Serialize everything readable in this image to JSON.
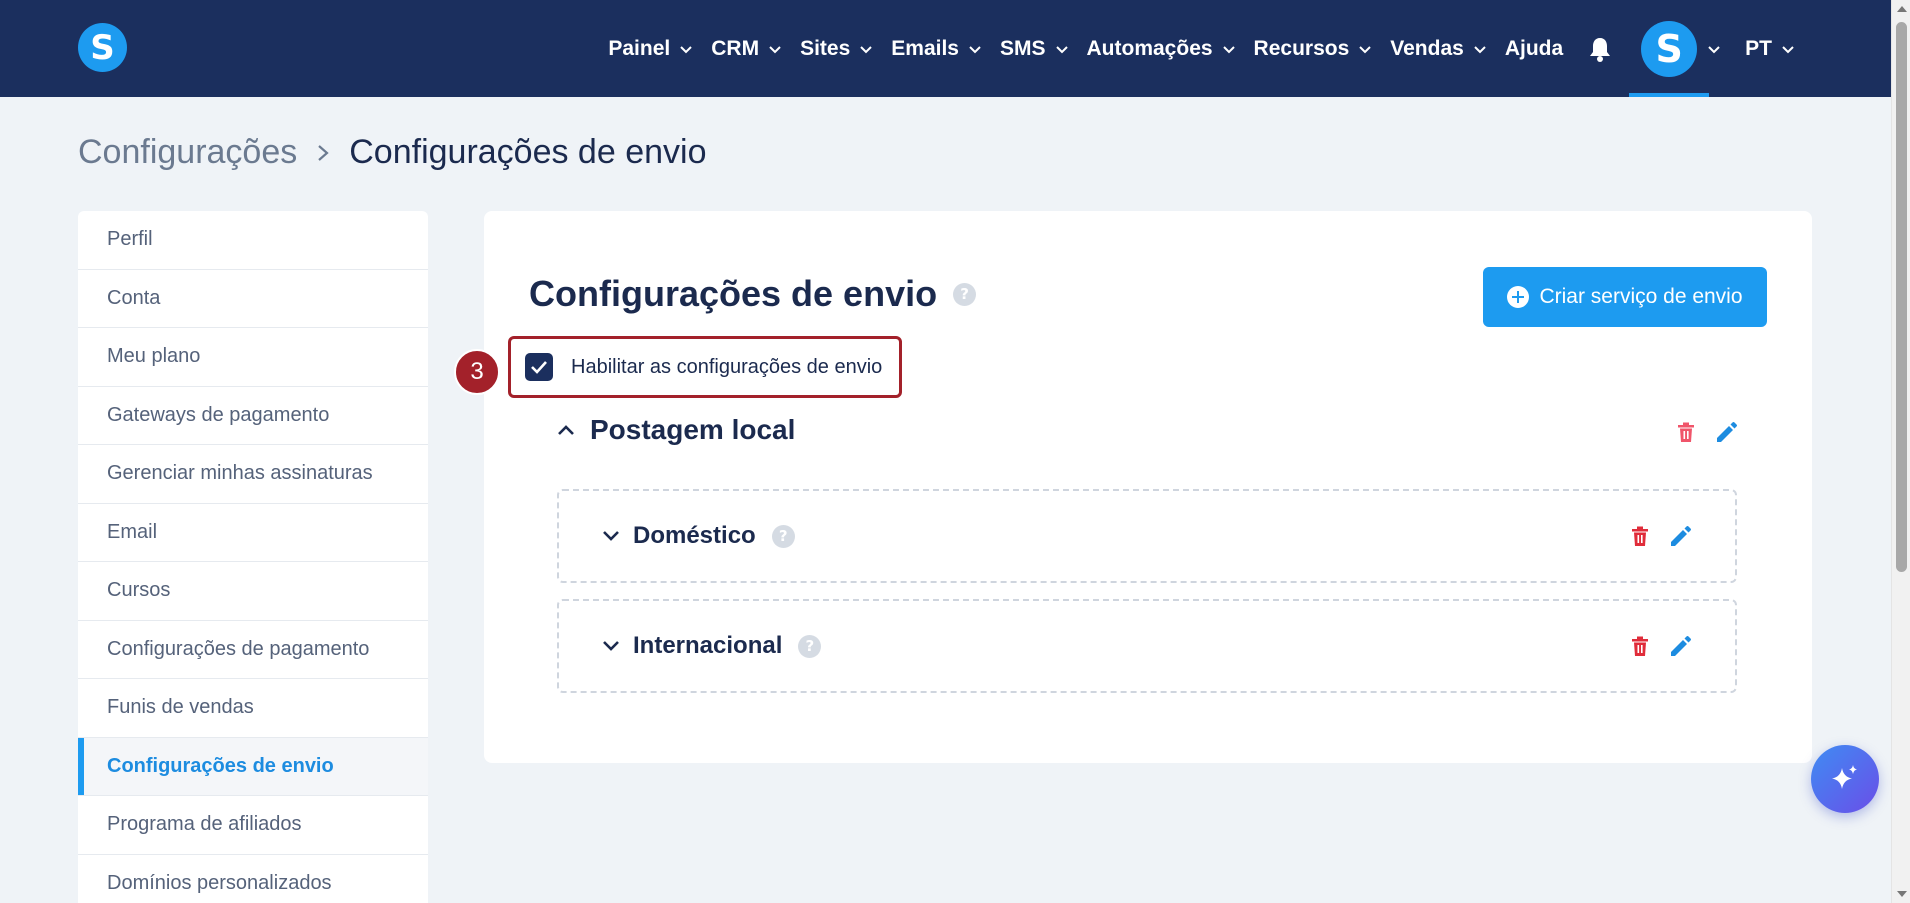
{
  "header": {
    "logo_letter": "S",
    "nav": [
      {
        "label": "Painel",
        "has_dropdown": true
      },
      {
        "label": "CRM",
        "has_dropdown": true
      },
      {
        "label": "Sites",
        "has_dropdown": true
      },
      {
        "label": "Emails",
        "has_dropdown": true
      },
      {
        "label": "SMS",
        "has_dropdown": true
      },
      {
        "label": "Automações",
        "has_dropdown": true
      },
      {
        "label": "Recursos",
        "has_dropdown": true
      },
      {
        "label": "Vendas",
        "has_dropdown": true
      },
      {
        "label": "Ajuda",
        "has_dropdown": false
      }
    ],
    "avatar_letter": "S",
    "language": "PT"
  },
  "breadcrumb": {
    "parent": "Configurações",
    "current": "Configurações de envio"
  },
  "sidebar": {
    "items": [
      {
        "label": "Perfil",
        "active": false
      },
      {
        "label": "Conta",
        "active": false
      },
      {
        "label": "Meu plano",
        "active": false
      },
      {
        "label": "Gateways de pagamento",
        "active": false
      },
      {
        "label": "Gerenciar minhas assinaturas",
        "active": false
      },
      {
        "label": "Email",
        "active": false
      },
      {
        "label": "Cursos",
        "active": false
      },
      {
        "label": "Configurações de pagamento",
        "active": false
      },
      {
        "label": "Funis de vendas",
        "active": false
      },
      {
        "label": "Configurações de envio",
        "active": true
      },
      {
        "label": "Programa de afiliados",
        "active": false
      },
      {
        "label": "Domínios personalizados",
        "active": false
      }
    ]
  },
  "main": {
    "title": "Configurações de envio",
    "help_glyph": "?",
    "create_button_label": "Criar serviço de envio",
    "enable_checkbox": {
      "label": "Habilitar as configurações de envio",
      "checked": true
    },
    "step_badge": "3",
    "group": {
      "title": "Postagem local",
      "expanded": true,
      "zones": [
        {
          "title": "Doméstico",
          "expanded": false
        },
        {
          "title": "Internacional",
          "expanded": false
        }
      ]
    }
  },
  "colors": {
    "header_bg": "#1b2f5e",
    "accent": "#1d9bf0",
    "highlight_border": "#a3212a",
    "delete_red": "#e02c3a"
  },
  "icons": {
    "bell": "bell-icon",
    "trash": "trash-icon",
    "pencil": "pencil-icon",
    "ai": "sparkle-icon"
  }
}
